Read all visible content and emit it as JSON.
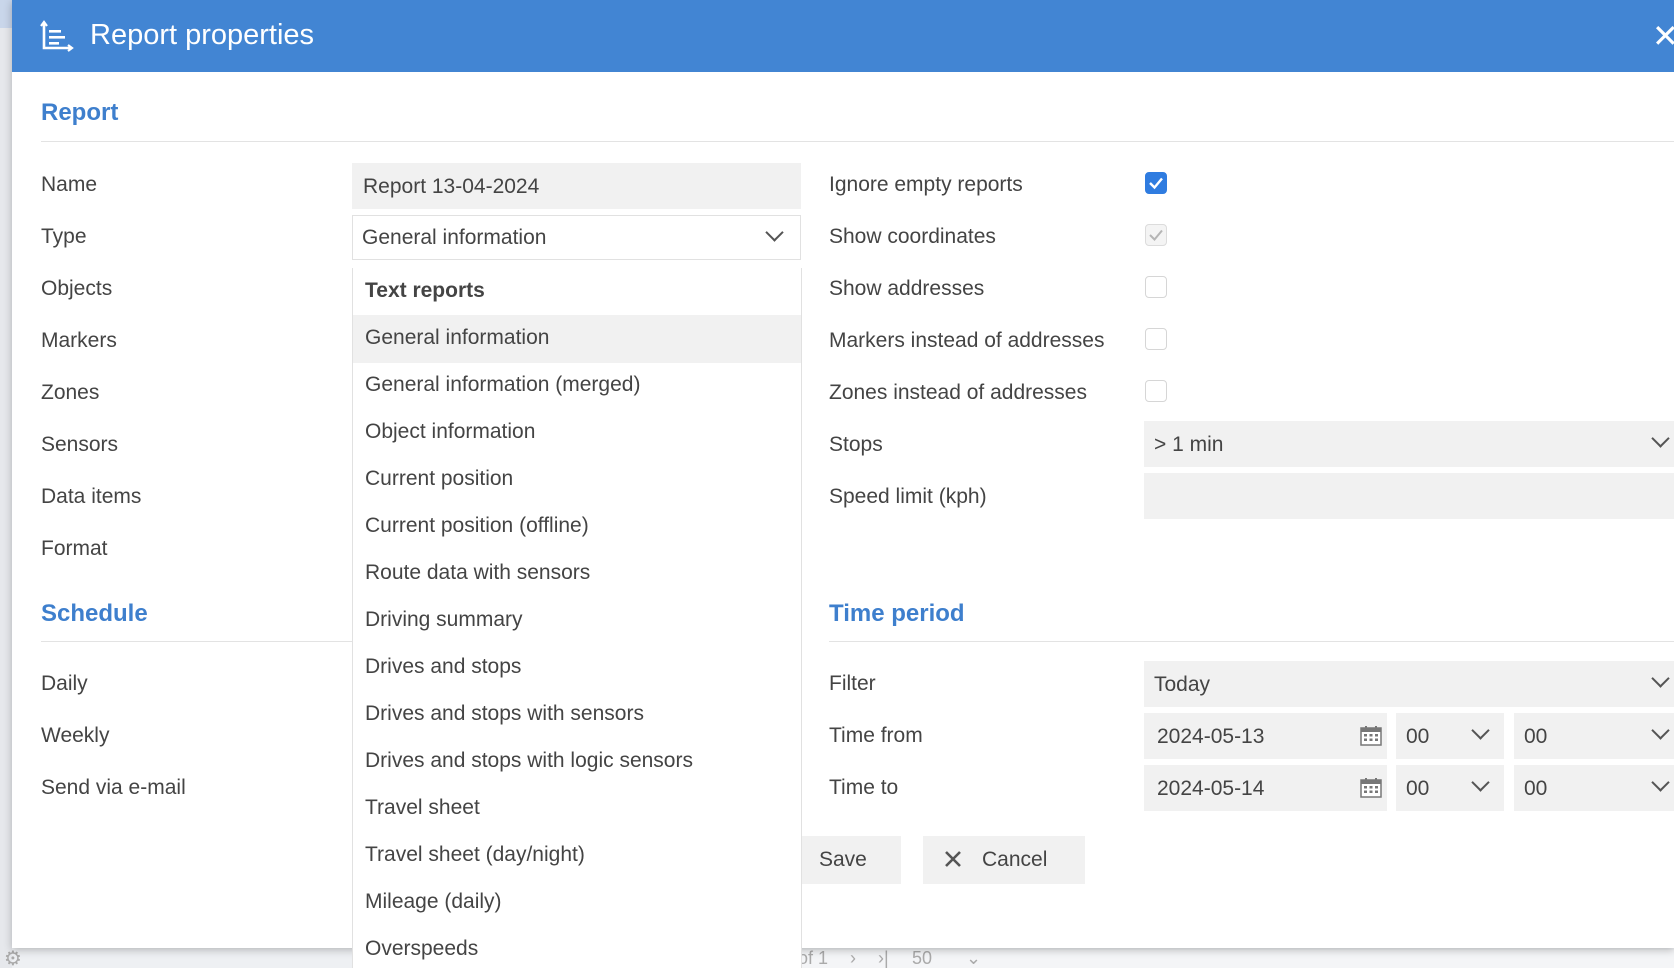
{
  "dialog": {
    "title": "Report properties",
    "icon": "report-chart-icon",
    "close_icon": "close-icon"
  },
  "report_section": {
    "title": "Report",
    "labels": {
      "name": "Name",
      "type": "Type",
      "objects": "Objects",
      "markers": "Markers",
      "zones": "Zones",
      "sensors": "Sensors",
      "data_items": "Data items",
      "format": "Format"
    },
    "name_value": "Report 13-04-2024",
    "type_value": "General information"
  },
  "type_dropdown": {
    "items": [
      {
        "label": "Text reports",
        "group": true
      },
      {
        "label": "General information",
        "selected": true
      },
      {
        "label": "General information (merged)"
      },
      {
        "label": "Object information"
      },
      {
        "label": "Current position"
      },
      {
        "label": "Current position (offline)"
      },
      {
        "label": "Route data with sensors"
      },
      {
        "label": "Driving summary"
      },
      {
        "label": "Drives and stops"
      },
      {
        "label": "Drives and stops with sensors"
      },
      {
        "label": "Drives and stops with logic sensors"
      },
      {
        "label": "Travel sheet"
      },
      {
        "label": "Travel sheet (day/night)"
      },
      {
        "label": "Mileage (daily)"
      },
      {
        "label": "Overspeeds"
      }
    ]
  },
  "options": {
    "ignore_empty": {
      "label": "Ignore empty reports",
      "checked": true
    },
    "show_coordinates": {
      "label": "Show coordinates",
      "checked": true,
      "disabled": true
    },
    "show_addresses": {
      "label": "Show addresses",
      "checked": false
    },
    "markers_instead": {
      "label": "Markers instead of addresses",
      "checked": false
    },
    "zones_instead": {
      "label": "Zones instead of addresses",
      "checked": false
    },
    "stops": {
      "label": "Stops",
      "value": "> 1 min"
    },
    "speed_limit": {
      "label": "Speed limit (kph)",
      "value": ""
    }
  },
  "schedule_section": {
    "title": "Schedule",
    "labels": {
      "daily": "Daily",
      "weekly": "Weekly",
      "send_email": "Send via e-mail"
    }
  },
  "time_period": {
    "title": "Time period",
    "filter": {
      "label": "Filter",
      "value": "Today"
    },
    "time_from": {
      "label": "Time from",
      "date": "2024-05-13",
      "hour": "00",
      "minute": "00"
    },
    "time_to": {
      "label": "Time to",
      "date": "2024-05-14",
      "hour": "00",
      "minute": "00"
    }
  },
  "buttons": {
    "save": "Save",
    "cancel": "Cancel"
  },
  "background": {
    "pager_of": "of 1",
    "pager_size": "50"
  },
  "colors": {
    "titlebar": "#4285d3",
    "accent": "#3e7fcd",
    "checkbox": "#2f7ce0"
  }
}
